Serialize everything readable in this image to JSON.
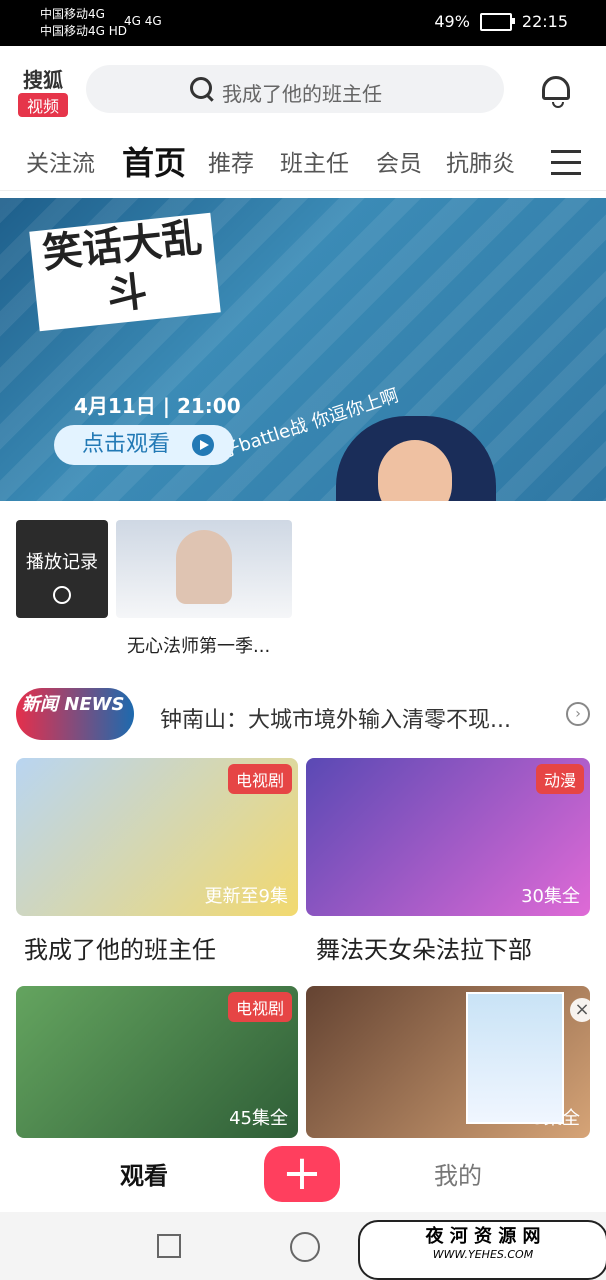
{
  "status": {
    "carrier1": "中国移动4G",
    "carrier2": "中国移动4G HD",
    "signal": "4G 4G",
    "battery": "49%",
    "time": "22:15"
  },
  "header": {
    "logo_top": "搜狐",
    "logo_bottom": "视频",
    "search_placeholder": "我成了他的班主任"
  },
  "nav": {
    "tabs": [
      "关注流",
      "首页",
      "推荐",
      "班主任",
      "会员",
      "抗肺炎"
    ]
  },
  "banner": {
    "title": "笑话大乱斗",
    "subtitle": "段子battle战 你逗你上啊",
    "date": "4月11日 | 21:00",
    "button": "点击观看"
  },
  "history": {
    "label": "播放记录",
    "movie_title": "无心法师第一季..."
  },
  "news": {
    "badge": "新闻 NEWS",
    "text": "钟南山：大城市境外输入清零不现..."
  },
  "cards": [
    {
      "tag": "电视剧",
      "episodes": "更新至9集",
      "title": "我成了他的班主任"
    },
    {
      "tag": "动漫",
      "episodes": "30集全",
      "title": "舞法天女朵法拉下部"
    },
    {
      "tag": "电视剧",
      "episodes": "45集全",
      "title": ""
    },
    {
      "tag": "",
      "episodes": "13集全",
      "title": ""
    }
  ],
  "bottom": {
    "watch": "观看",
    "plus": "+",
    "mine": "我的"
  },
  "watermark": {
    "line1": "夜 河 资 源 网",
    "line2": "WWW.YEHES.COM"
  }
}
